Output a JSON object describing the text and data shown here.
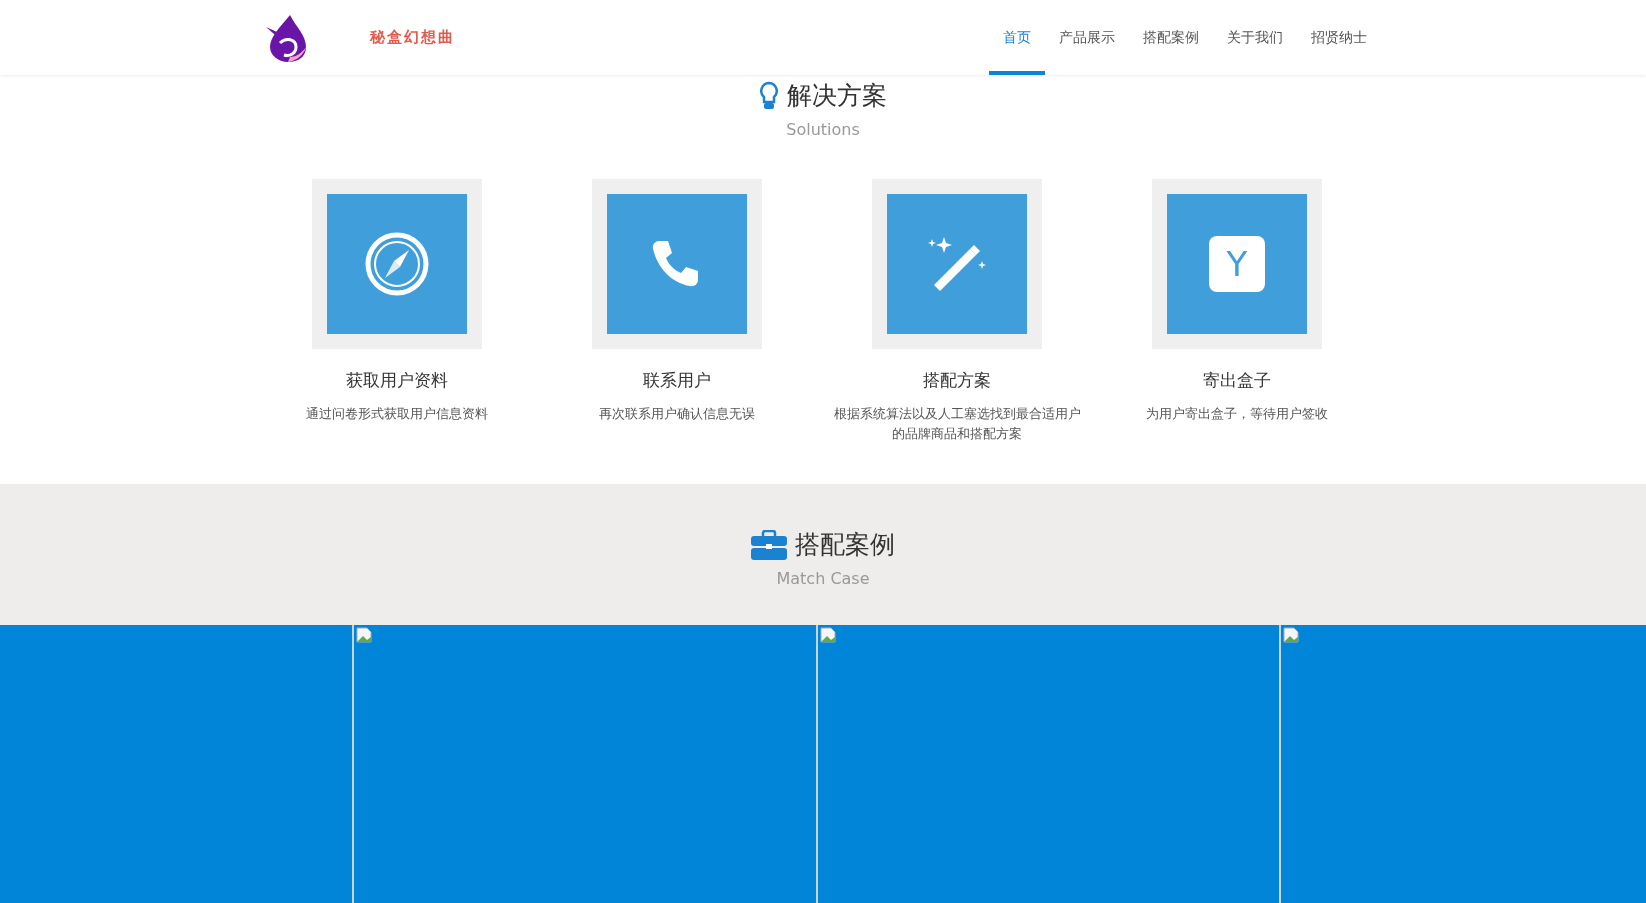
{
  "header": {
    "brand": "秘盒幻想曲",
    "nav": [
      {
        "label": "首页",
        "selected": true
      },
      {
        "label": "产品展示",
        "selected": false
      },
      {
        "label": "搭配案例",
        "selected": false
      },
      {
        "label": "关于我们",
        "selected": false
      },
      {
        "label": "招贤纳士",
        "selected": false
      }
    ]
  },
  "solutions": {
    "title": "解决方案",
    "subtitle": "Solutions",
    "items": [
      {
        "kind": "compass",
        "title": "获取用户资料",
        "desc": "通过问卷形式获取用户信息资料"
      },
      {
        "kind": "phone",
        "title": "联系用户",
        "desc": "再次联系用户确认信息无误"
      },
      {
        "kind": "wand",
        "title": "搭配方案",
        "desc": "根据系统算法以及人工塞选找到最合适用户的品牌商品和搭配方案"
      },
      {
        "kind": "letter",
        "title": "寄出盒子",
        "desc": "为用户寄出盒子，等待用户签收",
        "letter": "Y"
      }
    ]
  },
  "cases": {
    "title": "搭配案例",
    "subtitle": "Match Case",
    "panels": [
      {
        "kind": "plain"
      },
      {
        "kind": "broken-image"
      },
      {
        "kind": "broken-image"
      },
      {
        "kind": "broken-image"
      }
    ]
  }
}
